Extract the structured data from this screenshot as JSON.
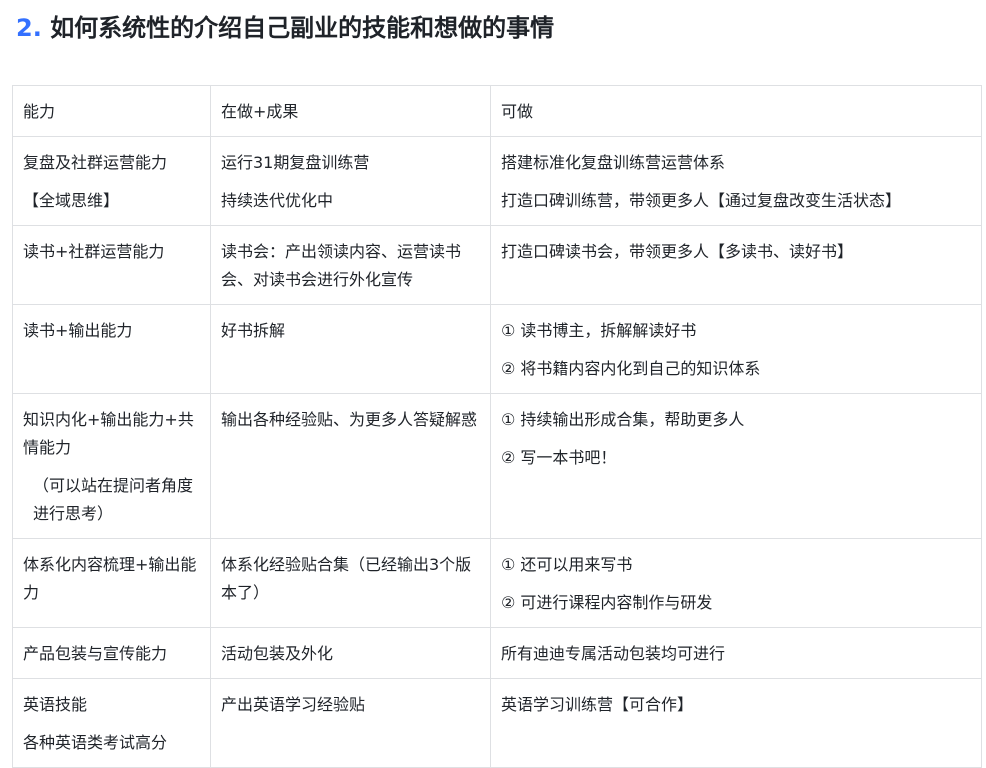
{
  "heading": {
    "number": "2.",
    "title": "如何系统性的介绍自己副业的技能和想做的事情"
  },
  "table": {
    "header": [
      "能力",
      "在做+成果",
      "可做"
    ],
    "rows": [
      {
        "ability": [
          "复盘及社群运营能力",
          "【全域思维】"
        ],
        "doing": [
          "运行31期复盘训练营",
          "持续迭代优化中"
        ],
        "todo": [
          "搭建标准化复盘训练营运营体系",
          "打造口碑训练营，带领更多人【通过复盘改变生活状态】"
        ]
      },
      {
        "ability": [
          "读书+社群运营能力"
        ],
        "doing": [
          "读书会：产出领读内容、运营读书会、对读书会进行外化宣传"
        ],
        "todo": [
          "打造口碑读书会，带领更多人【多读书、读好书】"
        ]
      },
      {
        "ability": [
          "读书+输出能力"
        ],
        "doing": [
          "好书拆解"
        ],
        "todo": [
          "① 读书博主，拆解解读好书",
          "② 将书籍内容内化到自己的知识体系"
        ]
      },
      {
        "ability": [
          "知识内化+输出能力+共情能力",
          "（可以站在提问者角度进行思考）"
        ],
        "doing": [
          "输出各种经验贴、为更多人答疑解惑"
        ],
        "todo": [
          "① 持续输出形成合集，帮助更多人",
          "② 写一本书吧！"
        ]
      },
      {
        "ability": [
          "体系化内容梳理+输出能力"
        ],
        "doing": [
          "体系化经验贴合集（已经输出3个版本了）"
        ],
        "todo": [
          "① 还可以用来写书",
          "② 可进行课程内容制作与研发"
        ]
      },
      {
        "ability": [
          "产品包装与宣传能力"
        ],
        "doing": [
          "活动包装及外化"
        ],
        "todo": [
          "所有迪迪专属活动包装均可进行"
        ]
      },
      {
        "ability": [
          "英语技能",
          "各种英语类考试高分"
        ],
        "doing": [
          "产出英语学习经验贴"
        ],
        "todo": [
          "英语学习训练营【可合作】"
        ]
      }
    ]
  }
}
